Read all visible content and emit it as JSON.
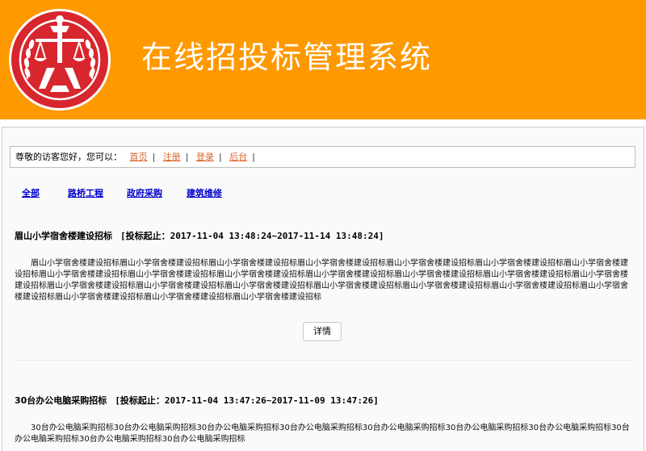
{
  "header": {
    "title": "在线招投标管理系统",
    "background_color": "#ff9900",
    "logo": {
      "icon": "court-emblem-icon",
      "color": "#d8262e"
    }
  },
  "welcome": {
    "prefix": "尊敬的访客您好，您可以：",
    "links": [
      "首页",
      "注册",
      "登录",
      "后台"
    ],
    "separator": "|"
  },
  "categories": [
    "全部",
    "路桥工程",
    "政府采购",
    "建筑维修"
  ],
  "items": [
    {
      "title": "眉山小学宿舍楼建设招标",
      "range": "[投标起止：2017-11-04 13:48:24~2017-11-14 13:48:24]",
      "description": "眉山小学宿舍楼建设招标眉山小学宿舍楼建设招标眉山小学宿舍楼建设招标眉山小学宿舍楼建设招标眉山小学宿舍楼建设招标眉山小学宿舍楼建设招标眉山小学宿舍楼建设招标眉山小学宿舍楼建设招标眉山小学宿舍楼建设招标眉山小学宿舍楼建设招标眉山小学宿舍楼建设招标眉山小学宿舍楼建设招标眉山小学宿舍楼建设招标眉山小学宿舍楼建设招标眉山小学宿舍楼建设招标眉山小学宿舍楼建设招标眉山小学宿舍楼建设招标眉山小学宿舍楼建设招标眉山小学宿舍楼建设招标眉山小学宿舍楼建设招标眉山小学宿舍楼建设招标眉山小学宿舍楼建设招标眉山小学宿舍楼建设招标眉山小学宿舍楼建设招标",
      "detail_label": "详情"
    },
    {
      "title": "30台办公电脑采购招标",
      "range": "[投标起止：2017-11-04 13:47:26~2017-11-09 13:47:26]",
      "description": "30台办公电脑采购招标30台办公电脑采购招标30台办公电脑采购招标30台办公电脑采购招标30台办公电脑采购招标30台办公电脑采购招标30台办公电脑采购招标30台办公电脑采购招标30台办公电脑采购招标30台办公电脑采购招标"
    }
  ]
}
